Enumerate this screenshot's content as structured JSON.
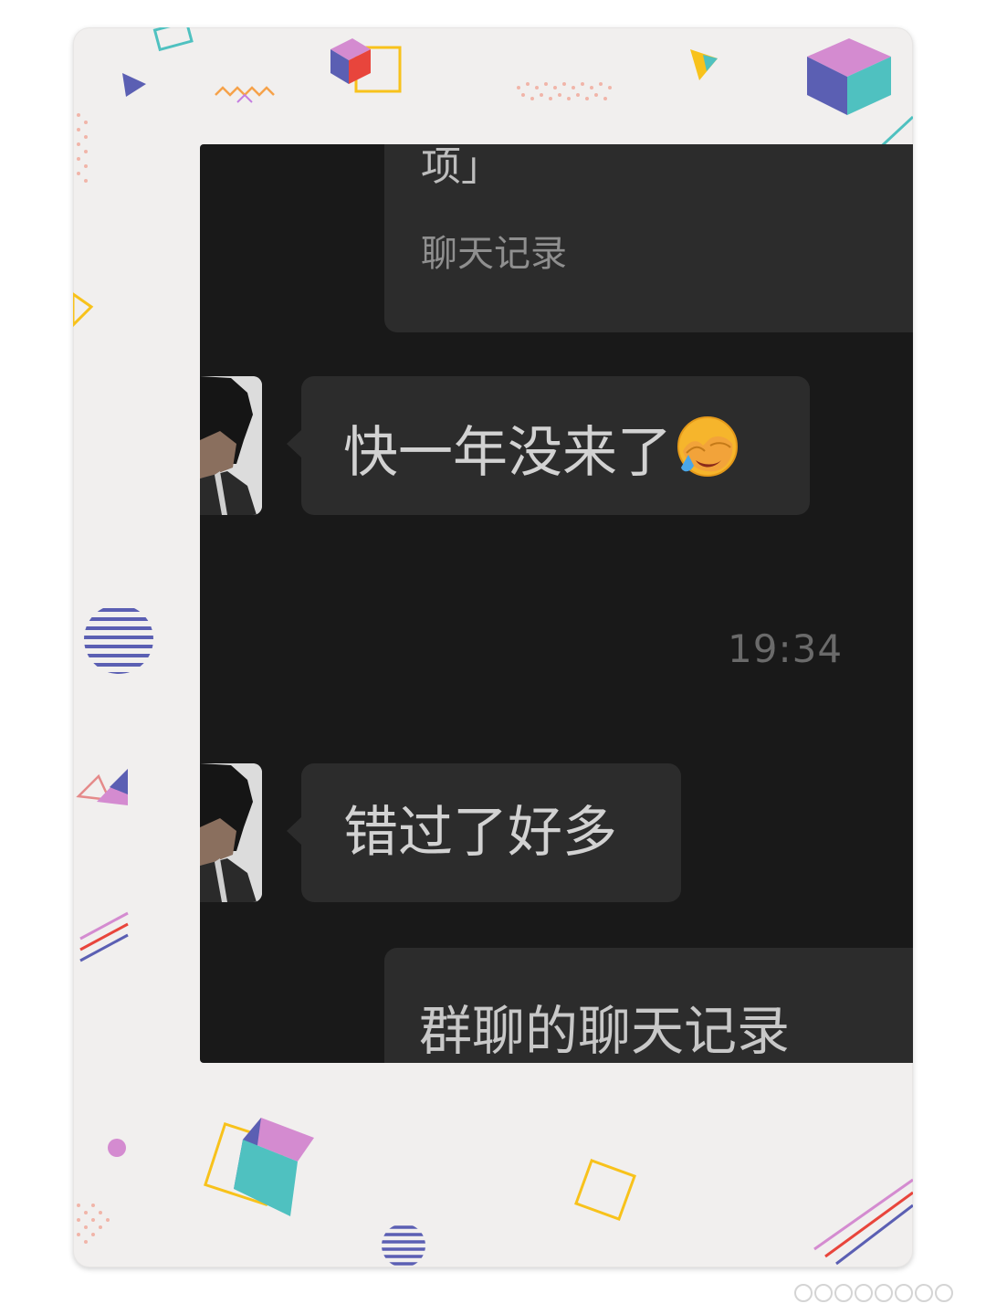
{
  "chat": {
    "forwarded_card_top": {
      "tail_text": "项」",
      "footer_label": "聊天记录"
    },
    "messages": [
      {
        "text": "快一年没来了",
        "emoji": "face-palm-laughing-emoji"
      },
      {
        "text": "错过了好多"
      }
    ],
    "timestamp": "19:34",
    "forwarded_card_bottom": {
      "title": "群聊的聊天记录"
    }
  },
  "colors": {
    "frame_bg": "#f1efee",
    "chat_bg": "#191919",
    "bubble_bg": "#2c2c2c",
    "accent_teal": "#4fc1c0",
    "accent_purple": "#5b5fb3",
    "accent_pink": "#d48bd0",
    "accent_yellow": "#f8c21b",
    "accent_red": "#e8453c"
  },
  "icons": [
    "avatar-anime-character",
    "face-palm-laughing-emoji",
    "cube-decoration",
    "watermark-dots"
  ]
}
